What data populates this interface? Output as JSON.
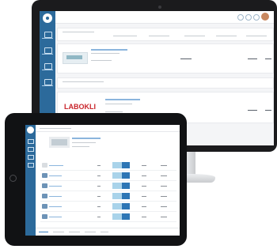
{
  "desktop": {
    "rows": [
      {
        "label": "",
        "title": "",
        "detail": "",
        "price": "",
        "price2": ""
      },
      {
        "label": "",
        "title": "",
        "detail": "",
        "price": "",
        "price2": ""
      },
      {
        "label": "",
        "title": "",
        "brand": "LABOKLI",
        "detail": "",
        "price": "",
        "price2": ""
      }
    ]
  },
  "tablet": {
    "rows": [
      {
        "status": "error"
      },
      {
        "status": "ok"
      },
      {
        "status": "ok"
      },
      {
        "status": "ok"
      },
      {
        "status": "ok"
      },
      {
        "status": "ok"
      },
      {
        "status": "ok"
      }
    ]
  },
  "colors": {
    "sidebar": "#2c6a9b",
    "link": "#3a7ec0",
    "brand_red": "#c9262c",
    "status_ok": "#3aa84b",
    "status_error": "#d33a3a"
  }
}
